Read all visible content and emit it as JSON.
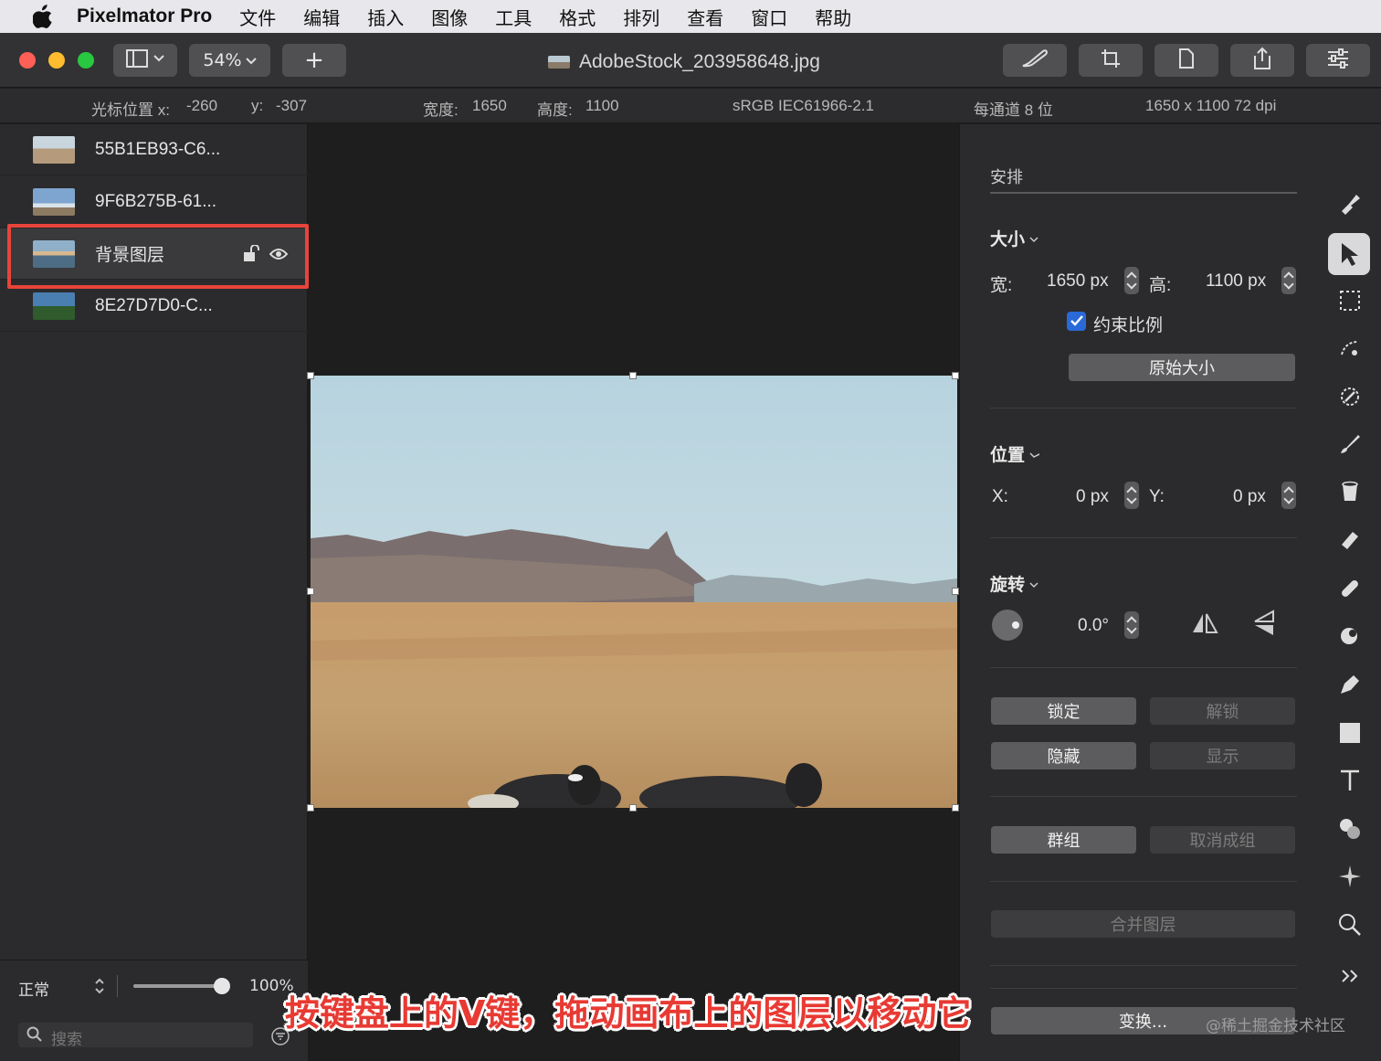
{
  "menubar": {
    "app_name": "Pixelmator Pro",
    "items": [
      "文件",
      "编辑",
      "插入",
      "图像",
      "工具",
      "格式",
      "排列",
      "查看",
      "窗口",
      "帮助"
    ]
  },
  "toolbar": {
    "zoom": "54%",
    "add_label": "+",
    "document_title": "AdobeStock_203958648.jpg"
  },
  "infobar": {
    "cursor_label": "光标位置 x:",
    "cursor_x": "-260",
    "cursor_y_label": "y:",
    "cursor_y": "-307",
    "width_label": "宽度:",
    "width": "1650",
    "height_label": "高度:",
    "height": "1100",
    "color_profile": "sRGB IEC61966-2.1",
    "bit_depth": "每通道 8 位",
    "dimensions_dpi": "1650 x 1100 72 dpi"
  },
  "layers": [
    {
      "name": "55B1EB93-C6...",
      "selected": false
    },
    {
      "name": "9F6B275B-61...",
      "selected": false
    },
    {
      "name": "背景图层",
      "selected": true
    },
    {
      "name": "8E27D7D0-C...",
      "selected": false
    }
  ],
  "sidebar_bottom": {
    "blend_mode": "正常",
    "opacity": "100%",
    "opacity_value": 1.0,
    "search_placeholder": "搜索"
  },
  "panel": {
    "tab_title": "安排",
    "size": {
      "title": "大小",
      "width_label": "宽:",
      "width_value": "1650 px",
      "height_label": "高:",
      "height_value": "1100 px",
      "constrain_label": "约束比例",
      "constrain_checked": true,
      "original_size_button": "原始大小"
    },
    "position": {
      "title": "位置",
      "x_label": "X:",
      "x_value": "0 px",
      "y_label": "Y:",
      "y_value": "0 px"
    },
    "rotation": {
      "title": "旋转",
      "value": "0.0°"
    },
    "buttons": {
      "lock": "锁定",
      "unlock": "解锁",
      "hide": "隐藏",
      "show": "显示",
      "group": "群组",
      "ungroup": "取消成组",
      "merge": "合并图层",
      "transform": "变换..."
    }
  },
  "caption": "按键盘上的V键，拖动画布上的图层以移动它",
  "watermark": "@稀土掘金技术社区",
  "colors": {
    "highlight": "#e8443a",
    "checkbox": "#2a6ad8"
  }
}
